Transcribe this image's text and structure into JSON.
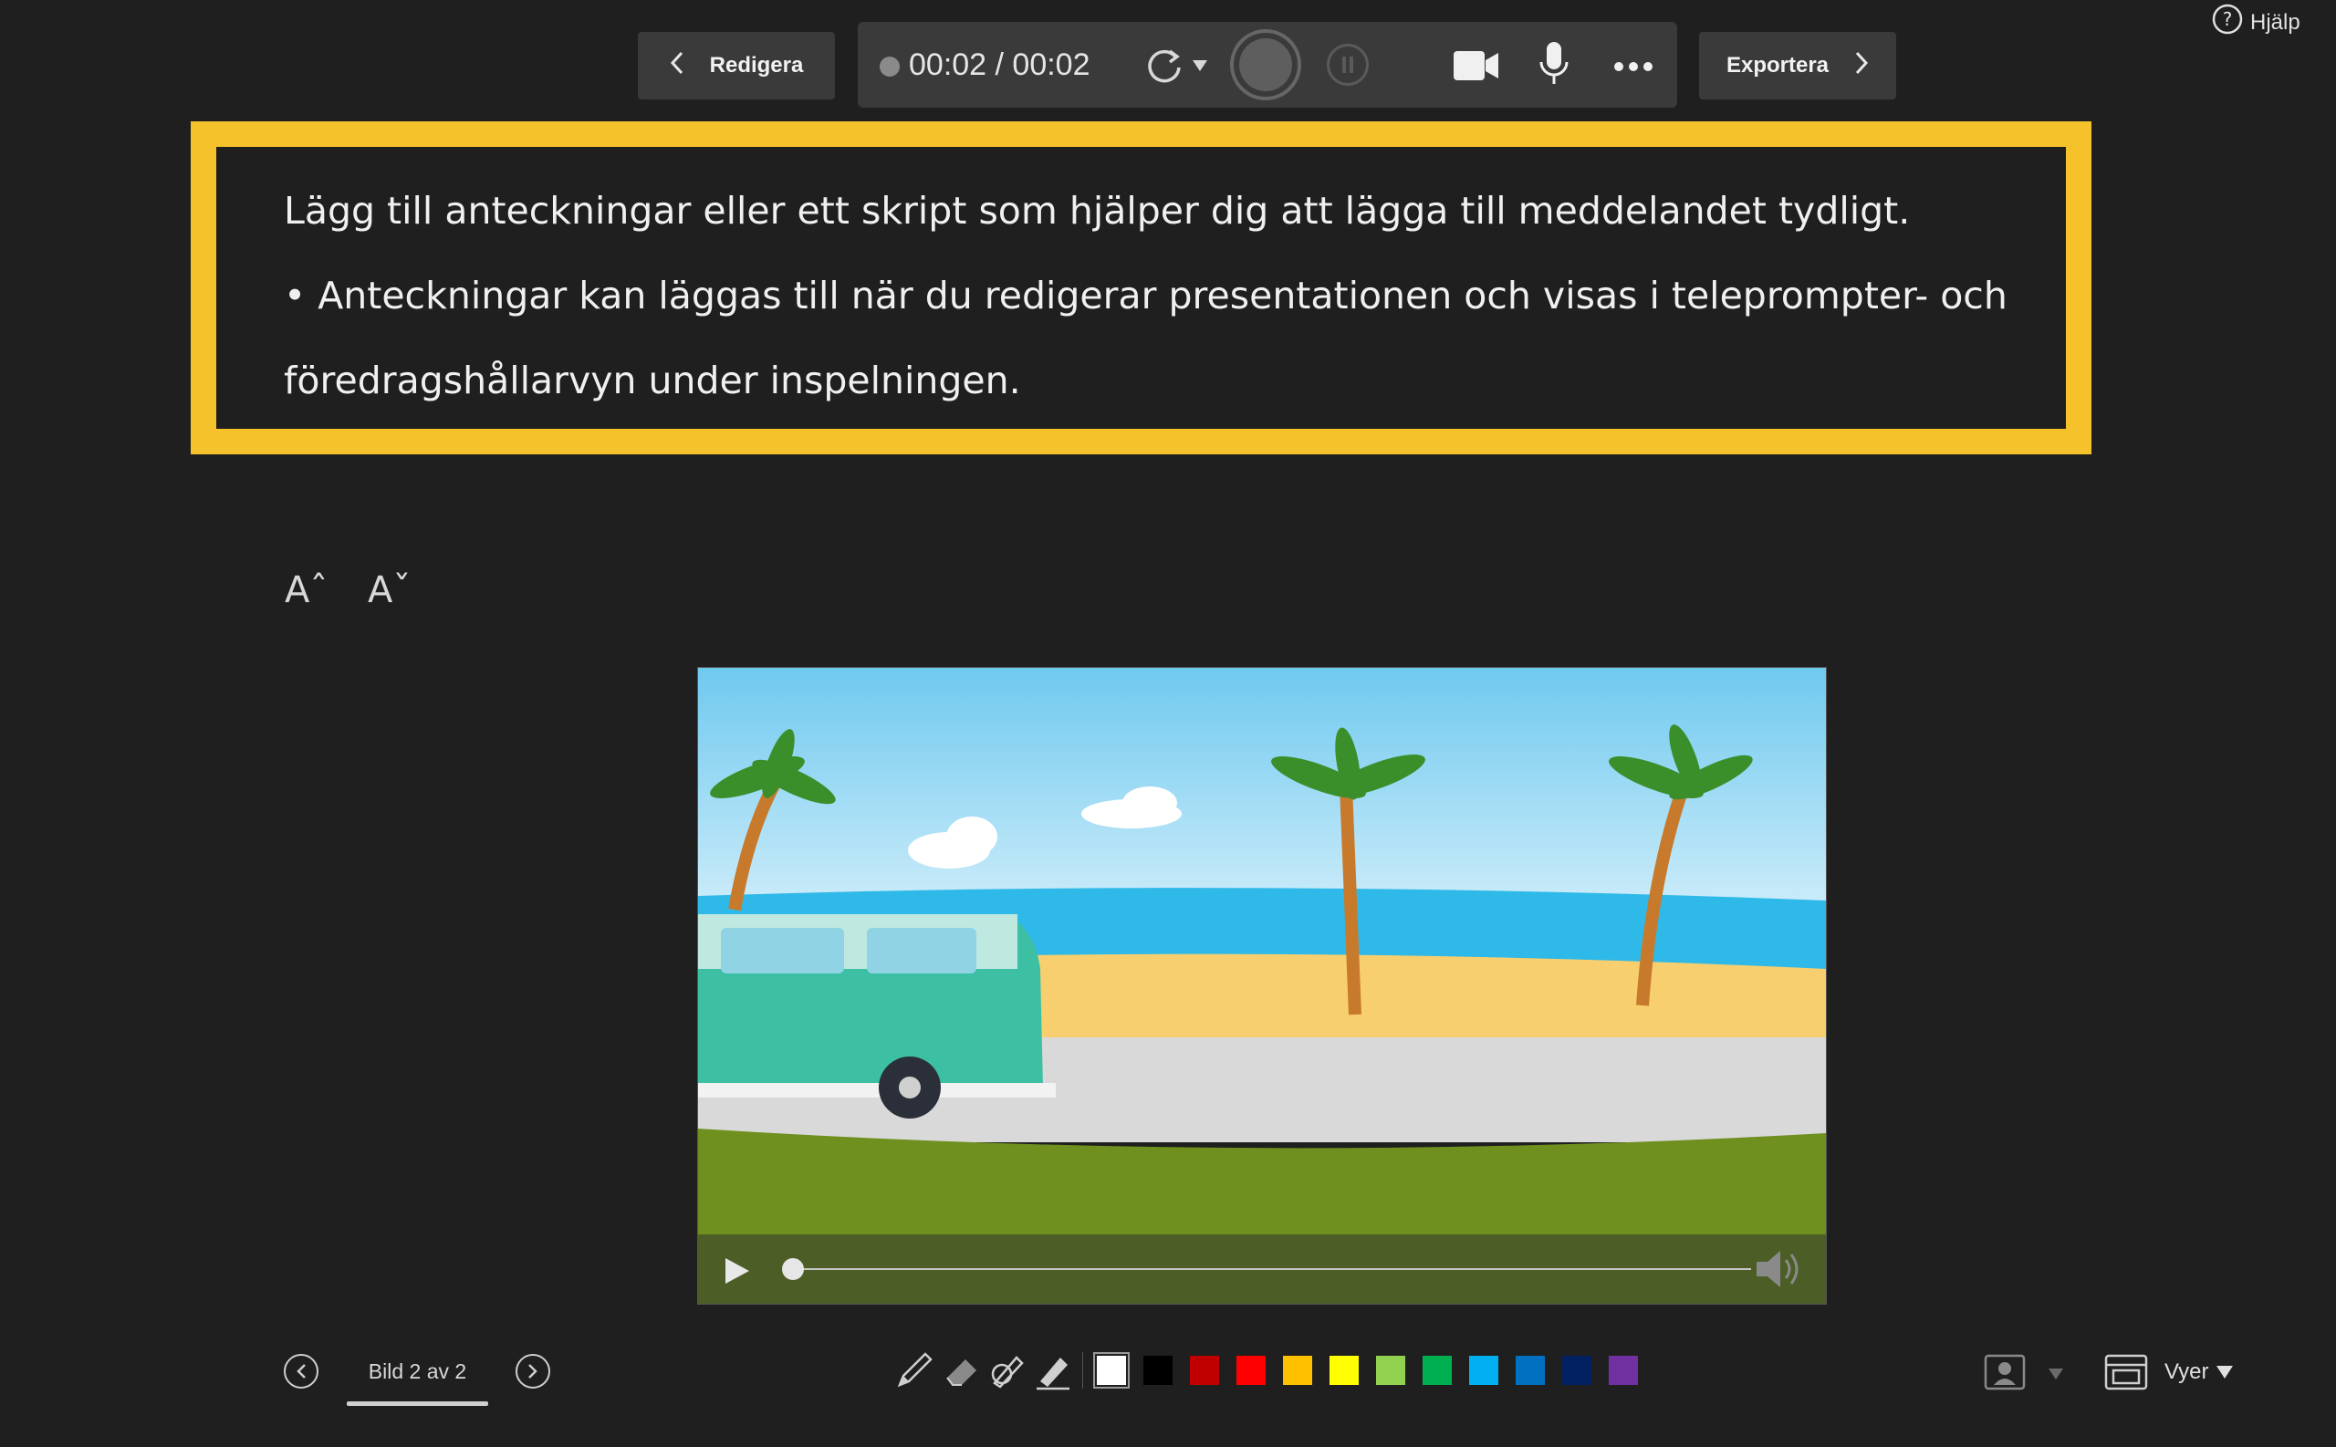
{
  "toolbar": {
    "edit_label": "Redigera",
    "timer": "00:02 / 00:02",
    "export_label": "Exportera",
    "help_label": "Hjälp"
  },
  "notes": {
    "line1": "Lägg till anteckningar eller ett skript som hjälper dig att lägga till meddelandet tydligt.",
    "line2": "• Anteckningar kan läggas till när du redigerar presentationen och visas i teleprompter- och",
    "line3": "föredragshållarvyn under inspelningen.",
    "highlight_color": "#f6c22c"
  },
  "font_controls": {
    "increase": "Aˆ",
    "decrease": "Aˇ"
  },
  "slide": {
    "video_progress": 0.0
  },
  "navigation": {
    "slide_indicator": "Bild 2 av 2"
  },
  "pen_colors": [
    "#ffffff",
    "#000000",
    "#c00000",
    "#ff0000",
    "#ffc000",
    "#ffff00",
    "#92d050",
    "#00b050",
    "#00b0f0",
    "#0070c0",
    "#002060",
    "#7030a0"
  ],
  "views": {
    "label": "Vyer"
  }
}
